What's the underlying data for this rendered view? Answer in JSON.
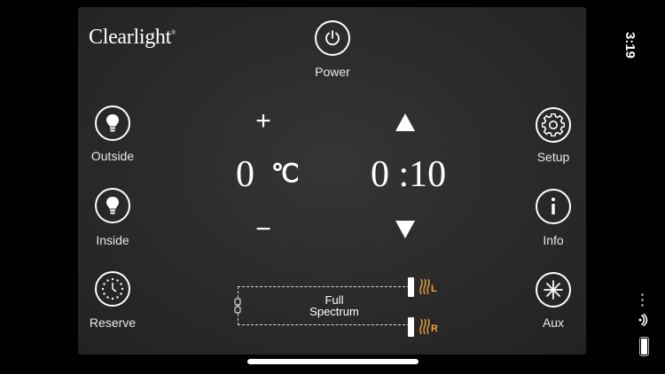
{
  "brand": {
    "name": "Clearlight",
    "mark": "®"
  },
  "power": {
    "label": "Power",
    "icon": "power-icon"
  },
  "left_controls": [
    {
      "label": "Outside",
      "icon": "lightbulb-icon"
    },
    {
      "label": "Inside",
      "icon": "lightbulb-icon"
    },
    {
      "label": "Reserve",
      "icon": "timer-icon"
    }
  ],
  "right_controls": [
    {
      "label": "Setup",
      "icon": "gear-icon"
    },
    {
      "label": "Info",
      "icon": "info-icon"
    },
    {
      "label": "Aux",
      "icon": "asterisk-icon"
    }
  ],
  "temperature": {
    "value": "0",
    "unit": "℃",
    "increase": "+",
    "decrease": "−"
  },
  "timer": {
    "value": "0 :10"
  },
  "heaters": {
    "label_line1": "Full",
    "label_line2": "Spectrum",
    "left_tag": "L",
    "right_tag": "R",
    "accent_color": "#f0a43c"
  },
  "status_bar": {
    "time": "3:19"
  }
}
